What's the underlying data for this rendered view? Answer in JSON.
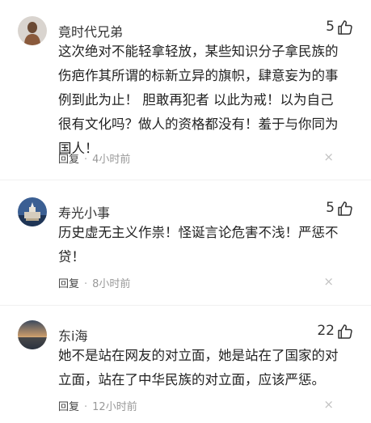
{
  "comments": [
    {
      "username": "竟时代兄弟",
      "likes": "5",
      "lines": [
        "这次绝对不能轻拿轻放，某些知识分子拿民族的",
        "伤疤作其所谓的标新立异的旗帜，肆意妄为的事",
        "例到此为止！ 胆敢再犯者 以此为戒！以为自己",
        "很有文化吗？做人的资格都没有！羞于与你同为",
        "国人！"
      ],
      "reply_label": "回复",
      "separator": "·",
      "time": "4小时前",
      "close": "×"
    },
    {
      "username": "寿光小事",
      "likes": "5",
      "lines": [
        "历史虚无主义作祟！怪诞言论危害不浅！严惩不",
        "贷！"
      ],
      "reply_label": "回复",
      "separator": "·",
      "time": "8小时前",
      "close": "×"
    },
    {
      "username": "东i海",
      "likes": "22",
      "lines": [
        "她不是站在网友的对立面，她是站在了国家的对",
        "立面，站在了中华民族的对立面，应该严惩。"
      ],
      "reply_label": "回复",
      "separator": "·",
      "time": "12小时前",
      "close": "×"
    }
  ],
  "icons": {
    "like": "thumbs-up-icon",
    "close": "close-icon"
  },
  "colors": {
    "text": "#222222",
    "meta": "#999999",
    "close": "#c2c2c2"
  }
}
